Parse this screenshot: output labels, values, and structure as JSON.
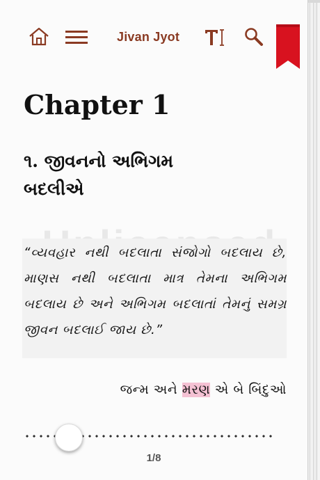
{
  "toolbar": {
    "title": "Jivan Jyot",
    "icons": [
      "home-icon",
      "menu-icon",
      "text-size-icon",
      "search-icon",
      "bookmark-icon"
    ],
    "accent_color": "#8a3a22",
    "bookmark_color": "#d8121f"
  },
  "content": {
    "chapter": "Chapter 1",
    "heading_line1": "૧. જીવનનો અભિગમ",
    "heading_line2": "બદલીએ",
    "watermark": "Unlicensed",
    "quote": "“વ્યવહાર નથી બદલાતા સંજોગો બદલાય છે, માણસ નથી બદલાતા માત્ર તેમના અભિગમ બદલાય છે અને અભિગમ બદલાતાં તેમનું સમગ્ર જીવન બદલાઈ જાય છે.”",
    "subline_before": "જન્મ અને ",
    "subline_highlight": "મરણ",
    "subline_after": " એ બે બિંદુઓ",
    "highlight_color": "#f4c1d3"
  },
  "footer": {
    "page_indicator": "1/8",
    "progress_fraction": 0.125
  }
}
